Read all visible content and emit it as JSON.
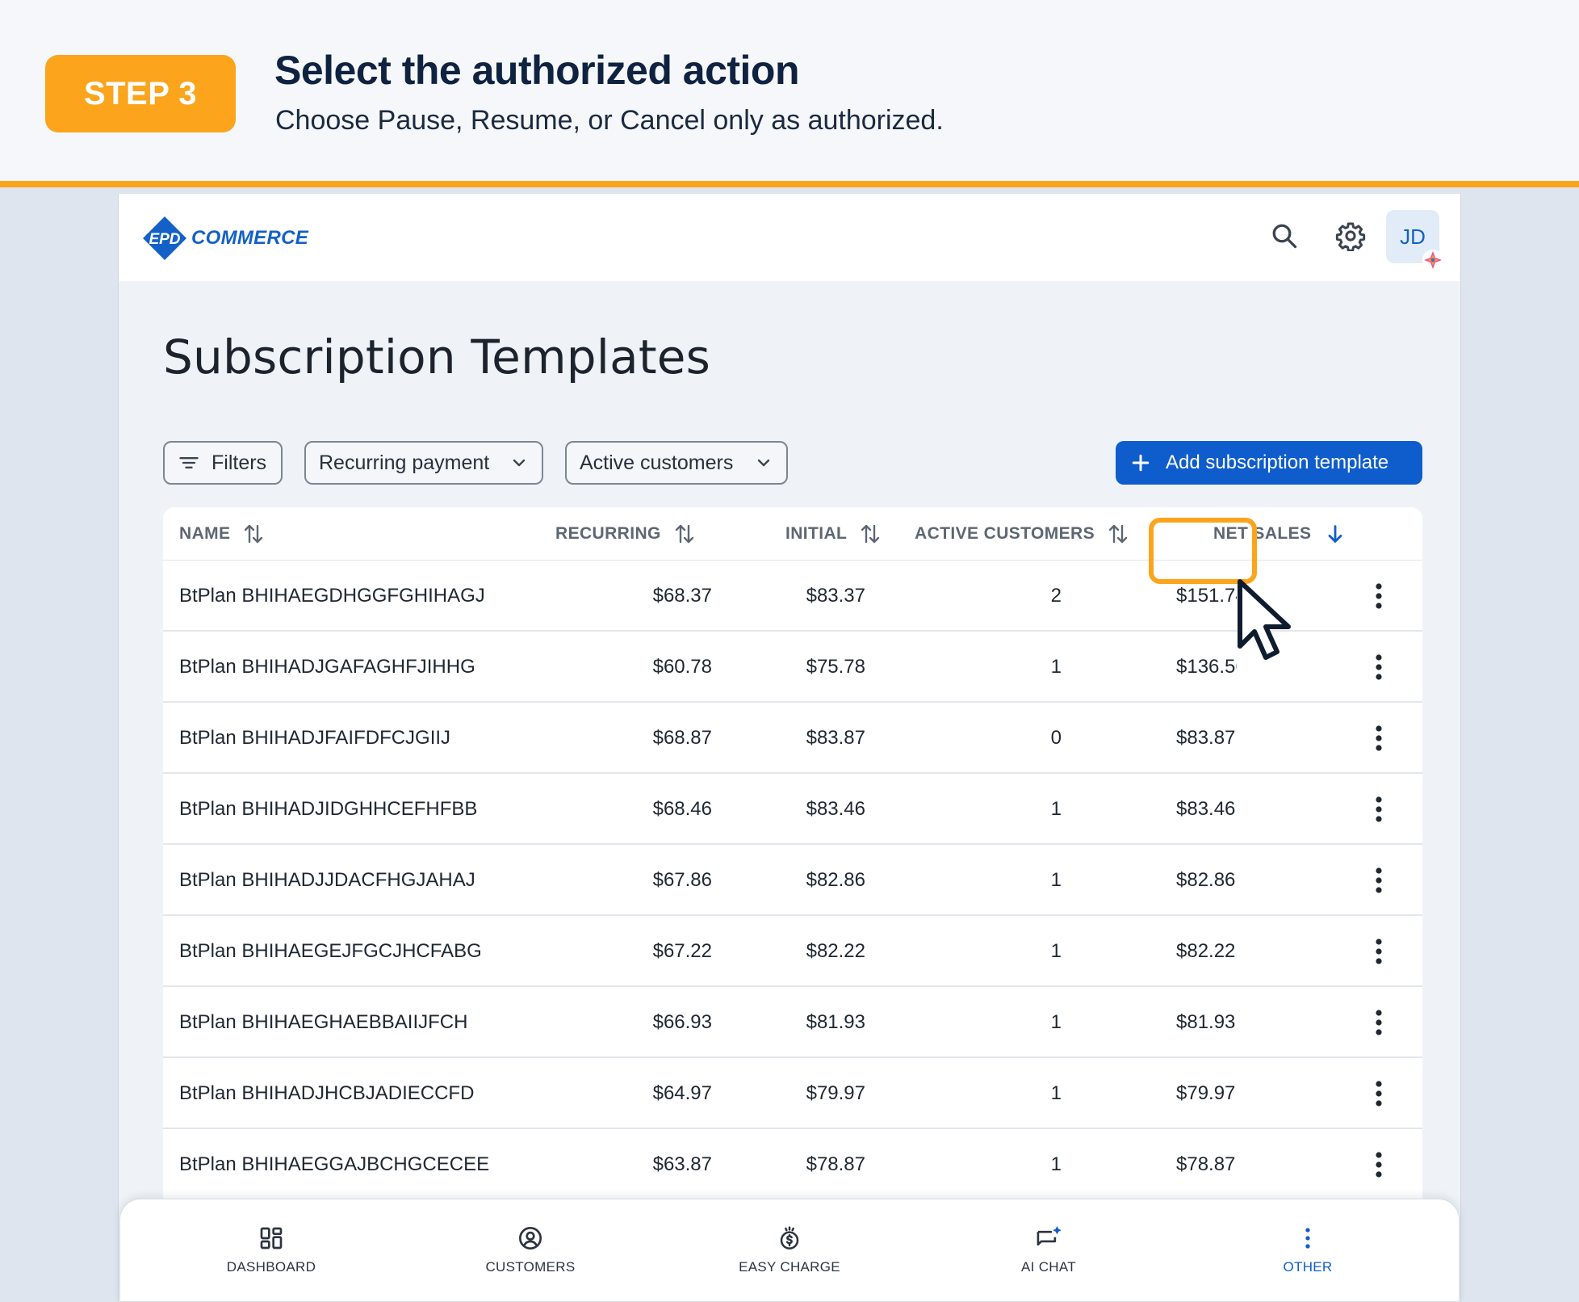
{
  "banner": {
    "step_label": "STEP 3",
    "title": "Select the authorized action",
    "subtitle": "Choose Pause, Resume, or Cancel only as authorized."
  },
  "topbar": {
    "logo_mark": "EPD",
    "logo_text": "COMMERCE",
    "avatar_initials": "JD"
  },
  "page": {
    "title": "Subscription Templates"
  },
  "filters": {
    "filters_label": "Filters",
    "recurring_label": "Recurring payment",
    "active_label": "Active customers",
    "add_label": "Add subscription template"
  },
  "table": {
    "headers": {
      "name": "NAME",
      "recurring": "RECURRING",
      "initial": "INITIAL",
      "active": "ACTIVE CUSTOMERS",
      "net": "NET SALES"
    },
    "rows": [
      {
        "name": "BtPlan BHIHAEGDHGGFGHIHAGJ",
        "recurring": "$68.37",
        "initial": "$83.37",
        "active": "2",
        "net": "$151.74"
      },
      {
        "name": "BtPlan BHIHADJGAFAGHFJIHHG",
        "recurring": "$60.78",
        "initial": "$75.78",
        "active": "1",
        "net": "$136.56"
      },
      {
        "name": "BtPlan BHIHADJFAIFDFCJGIIJ",
        "recurring": "$68.87",
        "initial": "$83.87",
        "active": "0",
        "net": "$83.87"
      },
      {
        "name": "BtPlan BHIHADJIDGHHCEFHFBB",
        "recurring": "$68.46",
        "initial": "$83.46",
        "active": "1",
        "net": "$83.46"
      },
      {
        "name": "BtPlan BHIHADJJDACFHGJAHAJ",
        "recurring": "$67.86",
        "initial": "$82.86",
        "active": "1",
        "net": "$82.86"
      },
      {
        "name": "BtPlan BHIHAEGEJFGCJHCFABG",
        "recurring": "$67.22",
        "initial": "$82.22",
        "active": "1",
        "net": "$82.22"
      },
      {
        "name": "BtPlan BHIHAEGHAEBBAIIJFCH",
        "recurring": "$66.93",
        "initial": "$81.93",
        "active": "1",
        "net": "$81.93"
      },
      {
        "name": "BtPlan BHIHADJHCBJADIECCFD",
        "recurring": "$64.97",
        "initial": "$79.97",
        "active": "1",
        "net": "$79.97"
      },
      {
        "name": "BtPlan BHIHAEGGAJBCHGCECEE",
        "recurring": "$63.87",
        "initial": "$78.87",
        "active": "1",
        "net": "$78.87"
      }
    ]
  },
  "nav": {
    "dashboard": "DASHBOARD",
    "customers": "CUSTOMERS",
    "easy_charge": "EASY CHARGE",
    "ai_chat": "AI CHAT",
    "other": "OTHER"
  },
  "colors": {
    "accent": "#fba41c",
    "primary": "#0f5dcc",
    "title": "#0f2340"
  }
}
